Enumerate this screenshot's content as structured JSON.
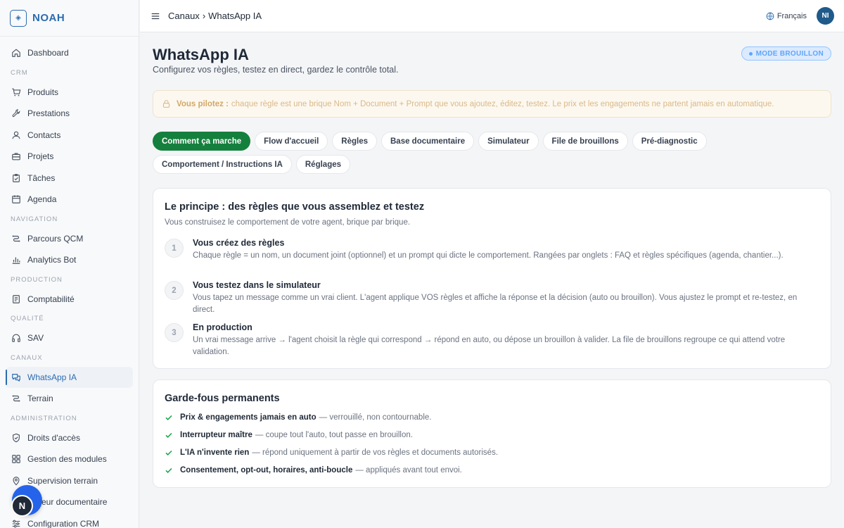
{
  "brand": {
    "name": "NOAH",
    "logo_glyph": "◈"
  },
  "sidebar": {
    "items": [
      {
        "type": "item",
        "label": "Dashboard",
        "icon": "home-icon"
      },
      {
        "type": "section",
        "label": "CRM"
      },
      {
        "type": "item",
        "label": "Produits",
        "icon": "cart-icon"
      },
      {
        "type": "item",
        "label": "Prestations",
        "icon": "wrench-icon"
      },
      {
        "type": "item",
        "label": "Contacts",
        "icon": "user-icon"
      },
      {
        "type": "item",
        "label": "Projets",
        "icon": "briefcase-icon"
      },
      {
        "type": "item",
        "label": "Tâches",
        "icon": "clipboard-icon"
      },
      {
        "type": "item",
        "label": "Agenda",
        "icon": "calendar-icon"
      },
      {
        "type": "section",
        "label": "NAVIGATION"
      },
      {
        "type": "item",
        "label": "Parcours QCM",
        "icon": "route-icon"
      },
      {
        "type": "item",
        "label": "Analytics Bot",
        "icon": "bar-chart-icon"
      },
      {
        "type": "section",
        "label": "PRODUCTION"
      },
      {
        "type": "item",
        "label": "Comptabilité",
        "icon": "ledger-icon"
      },
      {
        "type": "section",
        "label": "QUALITÉ"
      },
      {
        "type": "item",
        "label": "SAV",
        "icon": "headphones-icon"
      },
      {
        "type": "section",
        "label": "CANAUX"
      },
      {
        "type": "item",
        "label": "WhatsApp IA",
        "icon": "chat-icon",
        "active": true
      },
      {
        "type": "item",
        "label": "Terrain",
        "icon": "route-icon"
      },
      {
        "type": "section",
        "label": "ADMINISTRATION"
      },
      {
        "type": "item",
        "label": "Droits d'accès",
        "icon": "shield-icon"
      },
      {
        "type": "item",
        "label": "Gestion des modules",
        "icon": "grid-icon"
      },
      {
        "type": "item",
        "label": "Supervision terrain",
        "icon": "map-pin-icon"
      },
      {
        "type": "item",
        "label": "Moteur documentaire",
        "icon": "document-icon"
      },
      {
        "type": "item",
        "label": "Configuration CRM",
        "icon": "sliders-icon"
      }
    ]
  },
  "fab": {
    "dark_label": "N"
  },
  "topbar": {
    "breadcrumb": [
      "Canaux",
      "WhatsApp IA"
    ],
    "breadcrumb_separator": "›",
    "language": "Français",
    "avatar_initials": "NI"
  },
  "page": {
    "title": "WhatsApp IA",
    "subtitle": "Configurez vos règles, testez en direct, gardez le contrôle total.",
    "mode_badge": "MODE BROUILLON"
  },
  "alert": {
    "bold": "Vous pilotez :",
    "text": "chaque règle est une brique Nom + Document + Prompt que vous ajoutez, éditez, testez. Le prix et les engagements ne partent jamais en automatique."
  },
  "tabs": [
    {
      "label": "Comment ça marche",
      "active": true
    },
    {
      "label": "Flow d'accueil"
    },
    {
      "label": "Règles"
    },
    {
      "label": "Base documentaire"
    },
    {
      "label": "Simulateur"
    },
    {
      "label": "File de brouillons"
    },
    {
      "label": "Pré-diagnostic"
    },
    {
      "label": "Comportement / Instructions IA"
    },
    {
      "label": "Réglages"
    }
  ],
  "principle": {
    "title": "Le principe : des règles que vous assemblez et testez",
    "subtitle": "Vous construisez le comportement de votre agent, brique par brique.",
    "steps": [
      {
        "num": "1",
        "title": "Vous créez des règles",
        "desc": "Chaque règle = un nom, un document joint (optionnel) et un prompt qui dicte le comportement. Rangées par onglets : FAQ et règles spécifiques (agenda, chantier...)."
      },
      {
        "num": "2",
        "title": "Vous testez dans le simulateur",
        "desc": "Vous tapez un message comme un vrai client. L'agent applique VOS règles et affiche la réponse et la décision (auto ou brouillon). Vous ajustez le prompt et re-testez, en direct."
      },
      {
        "num": "3",
        "title": "En production",
        "desc": "Un vrai message arrive → l'agent choisit la règle qui correspond → répond en auto, ou dépose un brouillon à valider. La file de brouillons regroupe ce qui attend votre validation."
      }
    ]
  },
  "guardrails": {
    "title": "Garde-fous permanents",
    "items": [
      {
        "bold": "Prix & engagements jamais en auto",
        "text": "— verrouillé, non contournable."
      },
      {
        "bold": "Interrupteur maître",
        "text": "— coupe tout l'auto, tout passe en brouillon."
      },
      {
        "bold": "L'IA n'invente rien",
        "text": "— répond uniquement à partir de vos règles et documents autorisés."
      },
      {
        "bold": "Consentement, opt-out, horaires, anti-boucle",
        "text": "— appliqués avant tout envoi."
      }
    ]
  }
}
